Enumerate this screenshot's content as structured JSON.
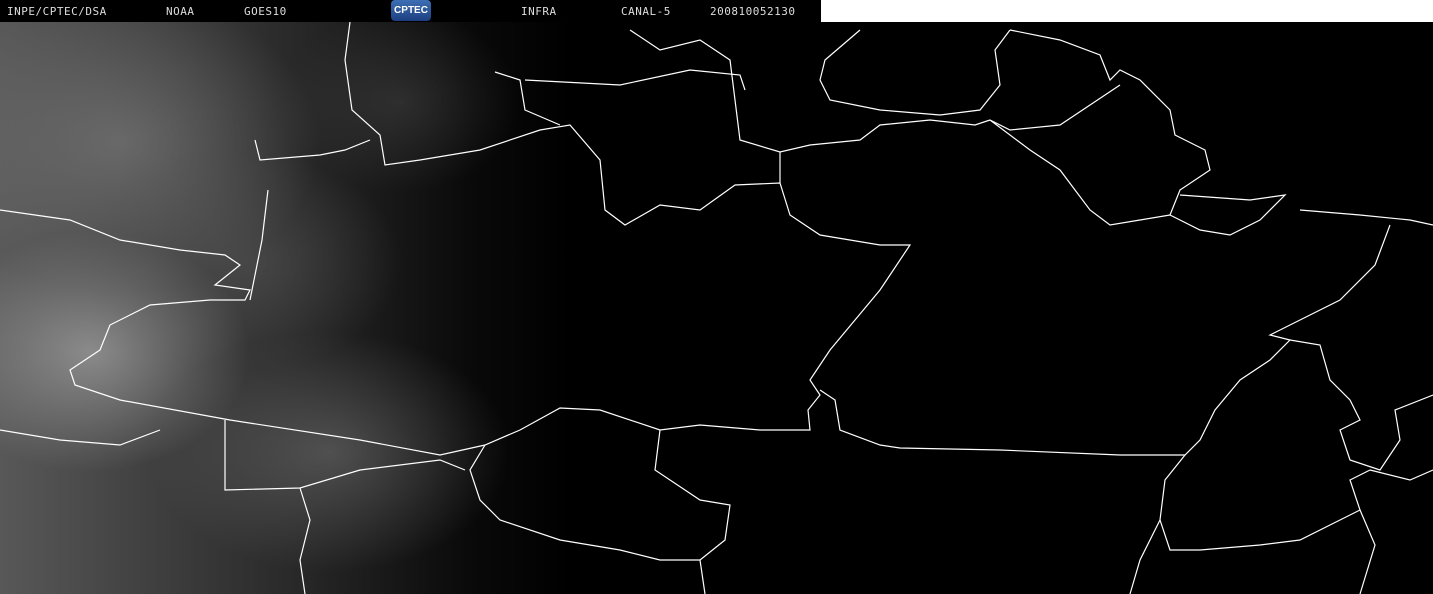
{
  "header": {
    "source": "INPE/CPTEC/DSA",
    "agency": "NOAA",
    "satellite": "GOES10",
    "logo_text": "CPTEC",
    "product": "INFRA",
    "channel": "CANAL-5",
    "datetime": "200810052130"
  },
  "colors": {
    "border_line": "#ffffff",
    "background": "#000000",
    "logo": "#2f5aa0"
  }
}
